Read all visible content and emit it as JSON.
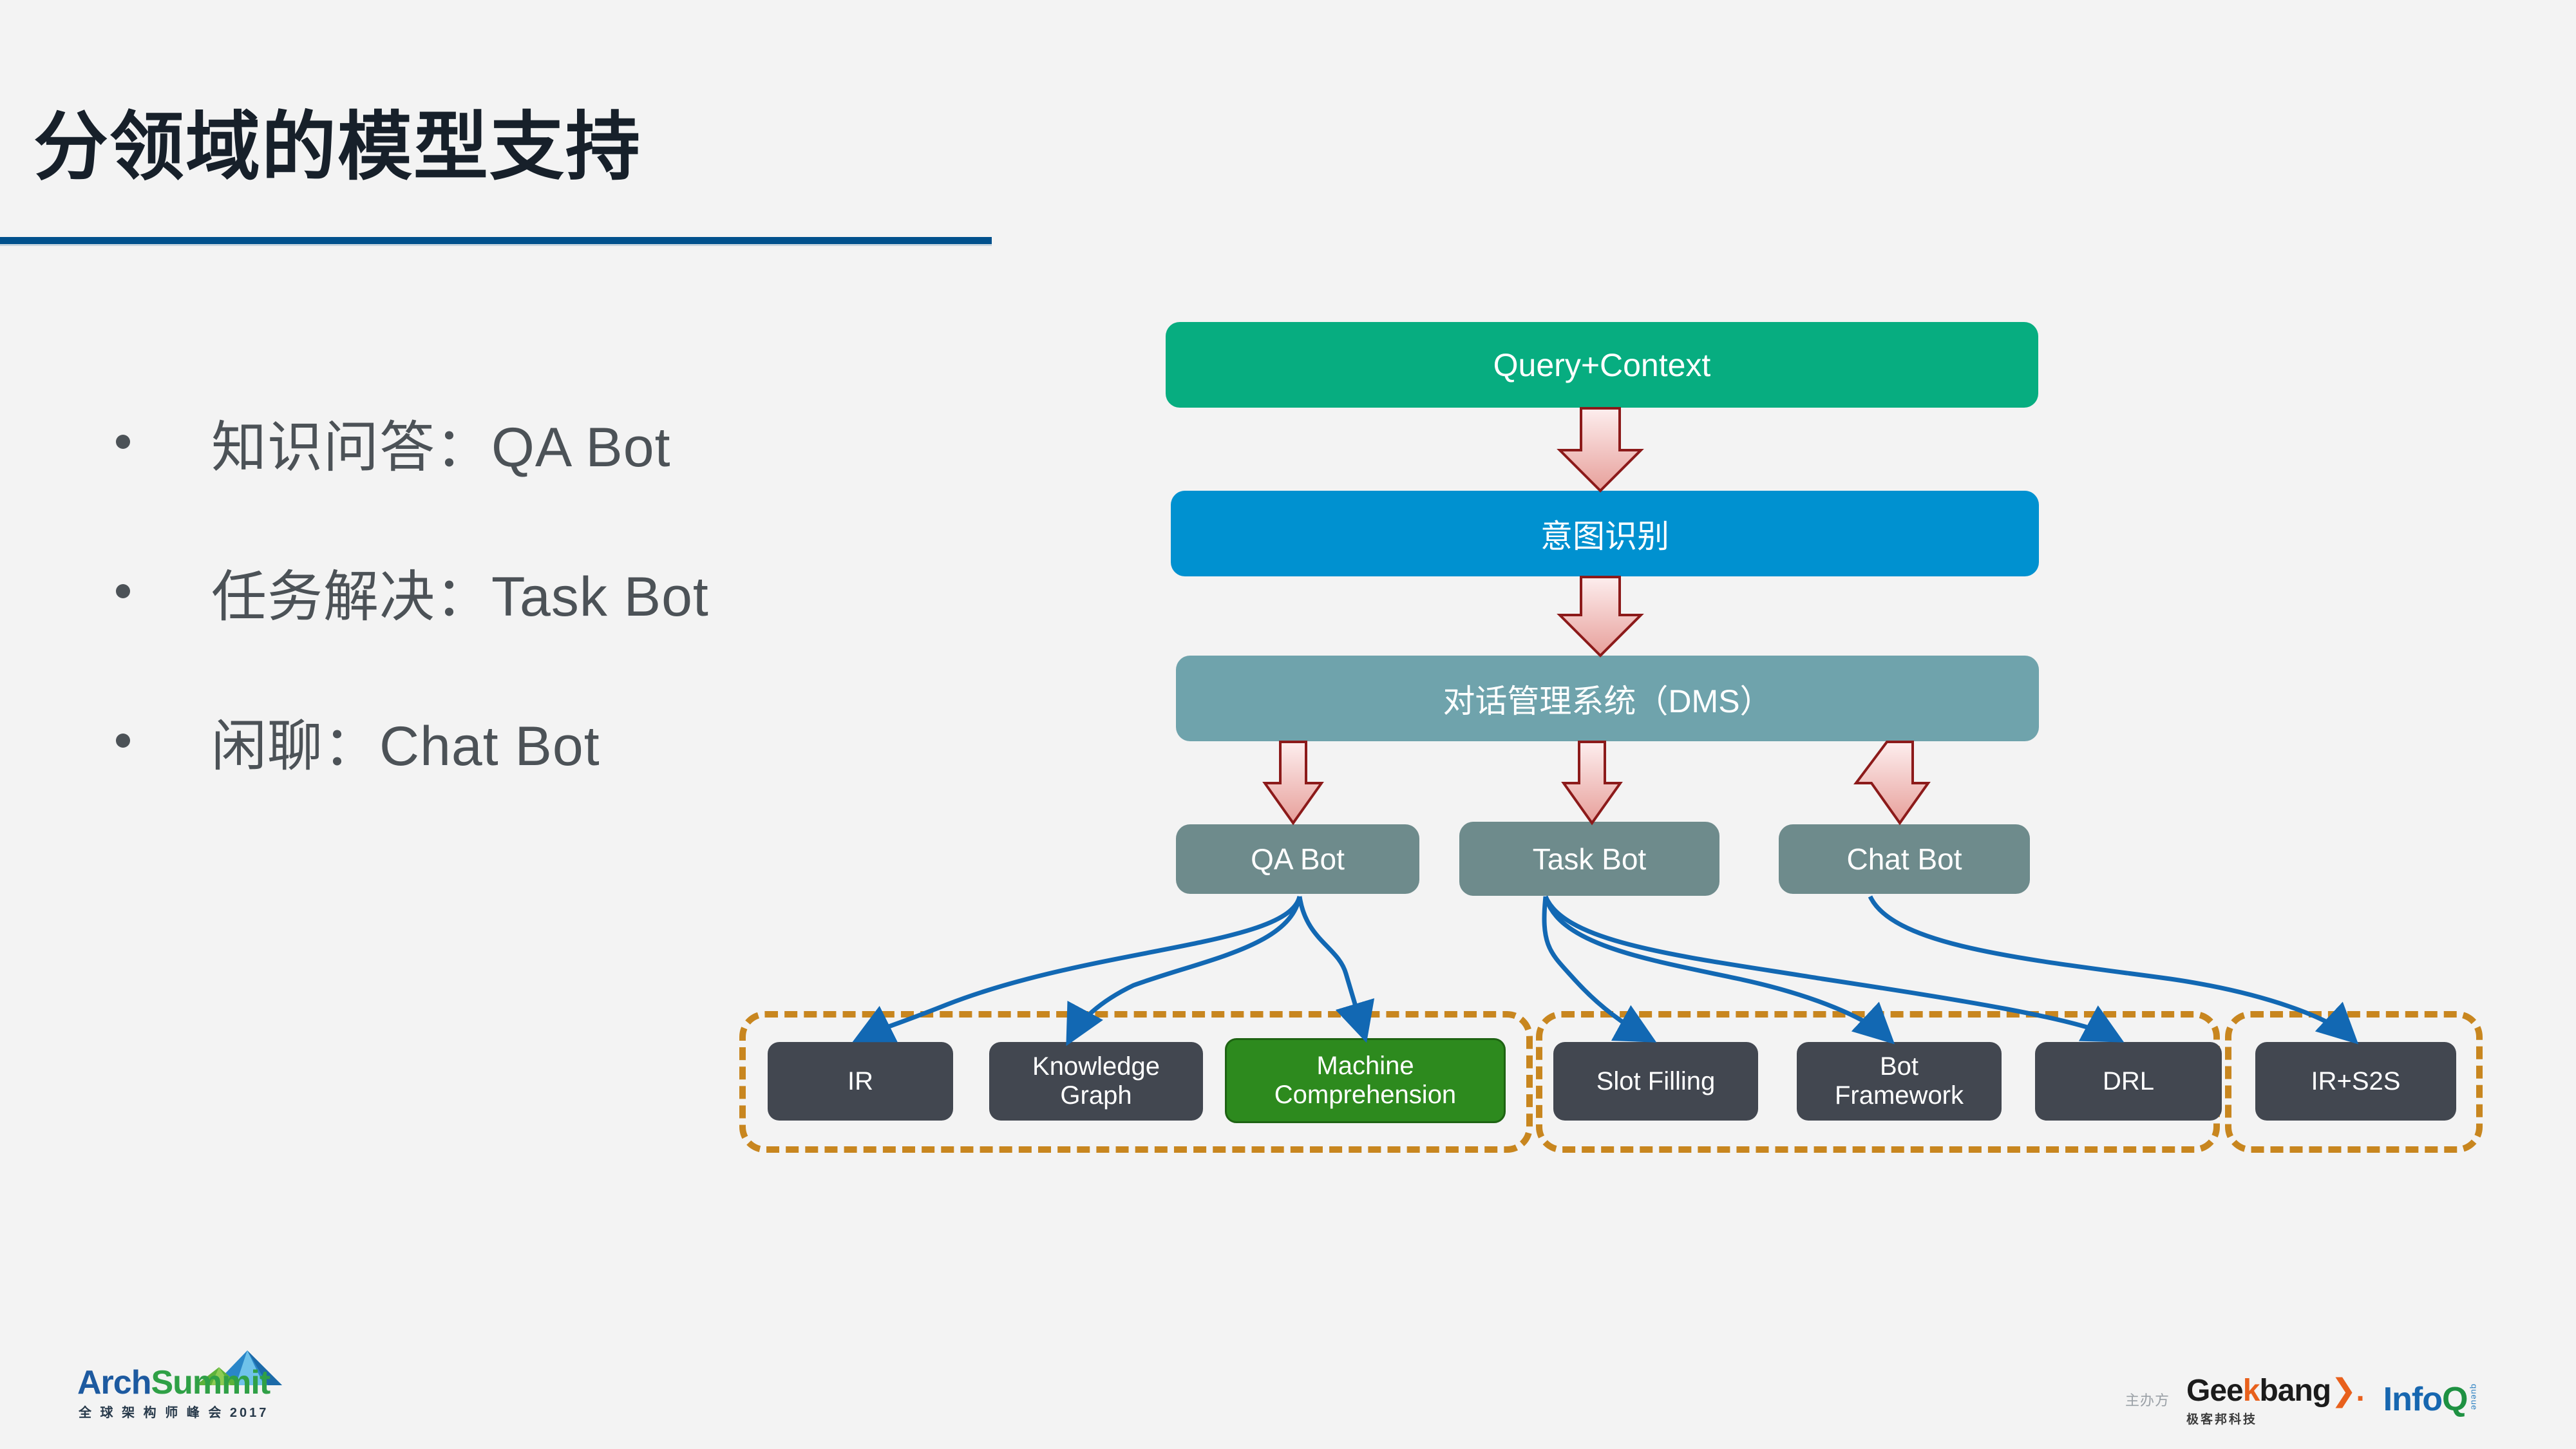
{
  "slide": {
    "title": "分领域的模型支持",
    "accent_blue": "#00508c",
    "background": "#f3f3f3"
  },
  "bullets": [
    {
      "text": "知识问答：QA Bot"
    },
    {
      "text": "任务解决：Task Bot"
    },
    {
      "text": "闲聊：Chat Bot"
    }
  ],
  "diagram": {
    "pipeline": [
      {
        "id": "query",
        "label": "Query+Context",
        "color": "#07ad80"
      },
      {
        "id": "intent",
        "label": "意图识别",
        "color": "#0091d0"
      },
      {
        "id": "dms",
        "label": "对话管理系统（DMS）",
        "color": "#6fa3ac"
      }
    ],
    "bots": [
      {
        "id": "qa",
        "label": "QA Bot",
        "color": "#6e8b8c"
      },
      {
        "id": "task",
        "label": "Task Bot",
        "color": "#6e8b8c"
      },
      {
        "id": "chat",
        "label": "Chat Bot",
        "color": "#6e8b8c"
      }
    ],
    "groups": [
      {
        "id": "qa-group",
        "parent": "QA Bot",
        "border_color": "#c8861f",
        "items": [
          {
            "label": "IR",
            "color": "#424750",
            "highlight": false
          },
          {
            "label": "Knowledge\nGraph",
            "color": "#424750",
            "highlight": false
          },
          {
            "label": "Machine\nComprehension",
            "color": "#2d8a1e",
            "highlight": true
          }
        ]
      },
      {
        "id": "task-group",
        "parent": "Task Bot",
        "border_color": "#c8861f",
        "items": [
          {
            "label": "Slot Filling",
            "color": "#424750",
            "highlight": false
          },
          {
            "label": "Bot\nFramework",
            "color": "#424750",
            "highlight": false
          },
          {
            "label": "DRL",
            "color": "#424750",
            "highlight": false
          }
        ]
      },
      {
        "id": "chat-group",
        "parent": "Chat Bot",
        "border_color": "#c8861f",
        "items": [
          {
            "label": "IR+S2S",
            "color": "#424750",
            "highlight": false
          }
        ]
      }
    ],
    "arrow_color": "#8c1a1a",
    "connector_color": "#1268b3"
  },
  "leaves": {
    "ir": "IR",
    "kg_line1": "Knowledge",
    "kg_line2": "Graph",
    "mc_line1": "Machine",
    "mc_line2": "Comprehension",
    "slot": "Slot Filling",
    "bf_line1": "Bot",
    "bf_line2": "Framework",
    "drl": "DRL",
    "irs2s": "IR+S2S"
  },
  "footer": {
    "archsummit": {
      "word_arch": "Arch",
      "word_summit": "Summit",
      "subtitle": "全 球 架 构 师 峰 会 2017"
    },
    "host_label": "主办方",
    "geekbang": {
      "word_pre": "Gee",
      "word_k": "k",
      "word_post": "bang",
      "word_arrow": "❯.",
      "subtitle": "极客邦科技"
    },
    "infoq": {
      "word_info": "Info",
      "word_q": "Q",
      "subtitle": "queue"
    }
  }
}
